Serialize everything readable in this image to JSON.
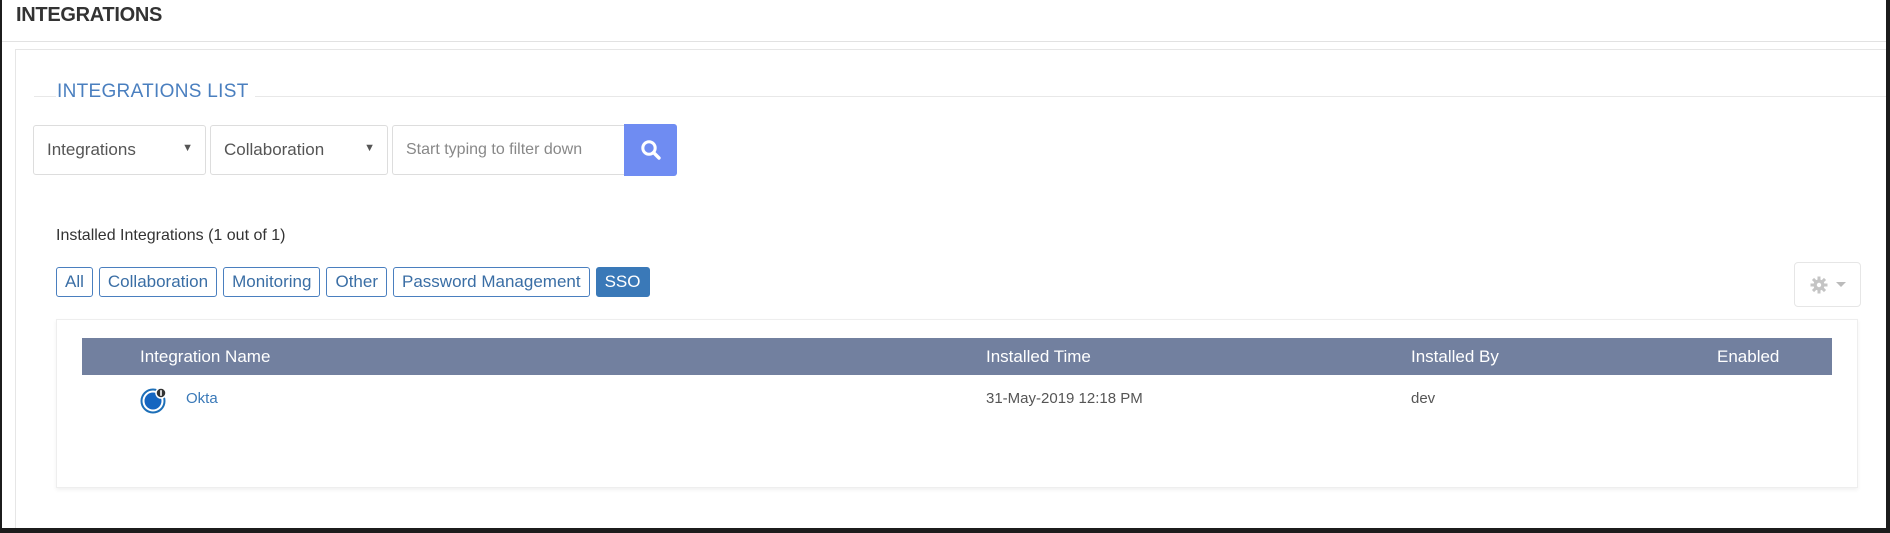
{
  "header": {
    "title": "INTEGRATIONS"
  },
  "section": {
    "title": "INTEGRATIONS LIST"
  },
  "filters": {
    "type_select": "Integrations",
    "category_select": "Collaboration",
    "search_placeholder": "Start typing to filter down",
    "search_value": ""
  },
  "installed": {
    "label": "Installed Integrations (1 out of 1)",
    "tags": [
      {
        "label": "All",
        "active": false
      },
      {
        "label": "Collaboration",
        "active": false
      },
      {
        "label": "Monitoring",
        "active": false
      },
      {
        "label": "Other",
        "active": false
      },
      {
        "label": "Password Management",
        "active": false
      },
      {
        "label": "SSO",
        "active": true
      }
    ]
  },
  "table": {
    "columns": [
      "Integration Name",
      "Installed Time",
      "Installed By",
      "Enabled"
    ],
    "rows": [
      {
        "name": "Okta",
        "installed_time": "31-May-2019 12:18 PM",
        "installed_by": "dev",
        "enabled": ""
      }
    ]
  },
  "icons": {
    "search": "search-icon",
    "gear": "gear-icon",
    "okta": "okta-logo-icon"
  },
  "colors": {
    "accent": "#4a7fbf",
    "search_button": "#6f8cf2",
    "table_header": "#72809f",
    "active_tag": "#3a79b8"
  }
}
